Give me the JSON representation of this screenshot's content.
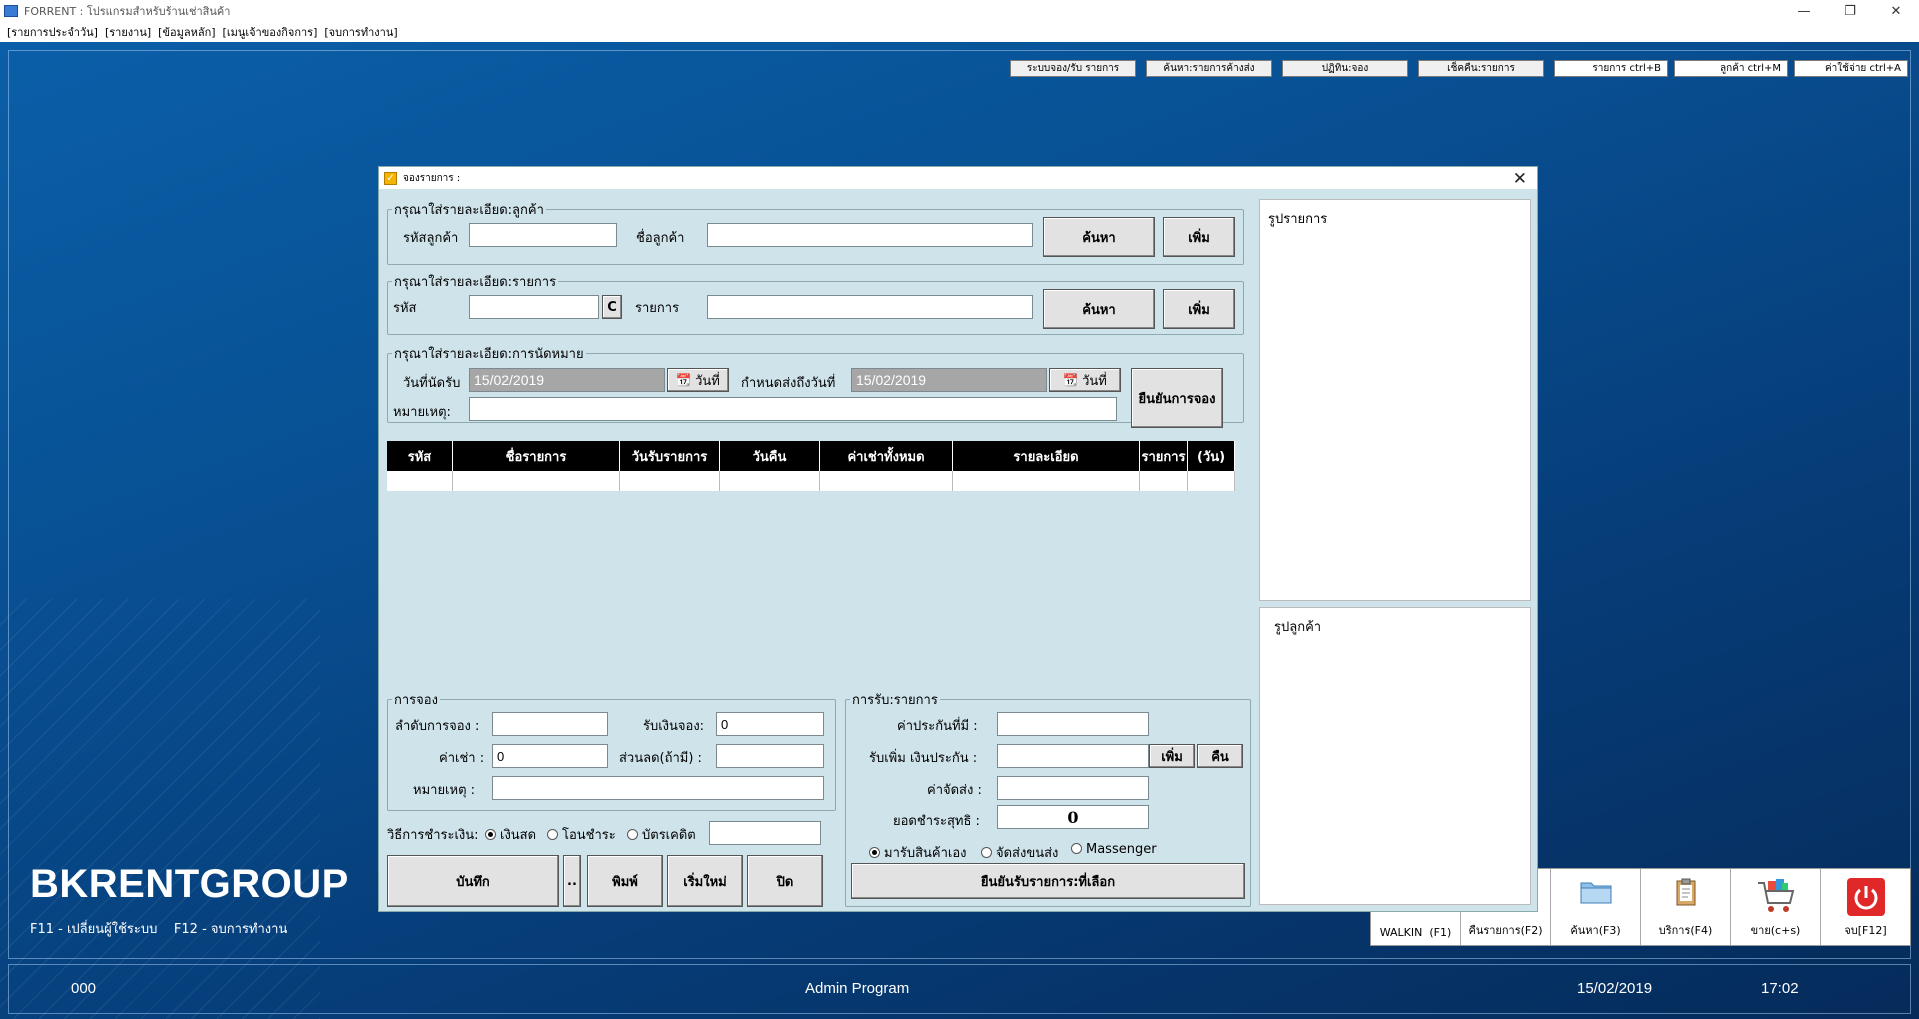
{
  "window": {
    "title": "FORRENT : โปรแกรมสำหรับร้านเช่าสินค้า",
    "controls": [
      "—",
      "❐",
      "✕"
    ]
  },
  "menu": [
    "[รายการประจำวัน]",
    "[รายงาน]",
    "[ข้อมูลหลัก]",
    "[เมนูเจ้าของกิจการ]",
    "[จบการทำงาน]"
  ],
  "top_buttons": [
    "ระบบจอง/รับ รายการ",
    "ค้นหา:รายการค้างส่ง",
    "ปฏิทิน:จอง",
    "เช็คคืน:รายการ",
    "รายการ ctrl+B",
    "ลูกค้า ctrl+M",
    "ค่าใช้จ่าย ctrl+A"
  ],
  "dialog": {
    "title": "จองรายการ :",
    "customer": {
      "legend": "กรุณาใส่รายละเอียด:ลูกค้า",
      "code_label": "รหัสลูกค้า",
      "code_value": "",
      "name_label": "ชื่อลูกค้า",
      "name_value": "",
      "search": "ค้นหา",
      "add": "เพิ่ม"
    },
    "item": {
      "legend": "กรุณาใส่รายละเอียด:รายการ",
      "code_label": "รหัส",
      "code_value": "",
      "c_button": "C",
      "item_label": "รายการ",
      "item_value": "",
      "search": "ค้นหา",
      "add": "เพิ่ม"
    },
    "appointment": {
      "legend": "กรุณาใส่รายละเอียด:การนัดหมาย",
      "pickup_label": "วันที่นัดรับ",
      "pickup_date": "15/02/2019",
      "date_button": "วันที่",
      "return_label": "กำหนดส่งถึงวันที่",
      "return_date": "15/02/2019",
      "note_label": "หมายเหตุ:",
      "note_value": "",
      "confirm": "ยืนยันการจอง"
    },
    "table": {
      "columns": [
        "รหัส",
        "ชื่อรายการ",
        "วันรับรายการ",
        "วันคืน",
        "ค่าเช่าทั้งหมด",
        "รายละเอียด",
        "รายการ",
        "(วัน)"
      ]
    },
    "booking": {
      "legend": "การจอง",
      "seq_label": "ลำดับการจอง :",
      "seq_value": "",
      "deposit_label": "รับเงินจอง:",
      "deposit_value": "0",
      "rent_label": "ค่าเช่า :",
      "rent_value": "0",
      "discount_label": "ส่วนลด(ถ้ามี) :",
      "discount_value": "",
      "note_label": "หมายเหตุ :",
      "note_value": ""
    },
    "payment": {
      "label": "วิธีการชำระเงิน:",
      "options": [
        "เงินสด",
        "โอนชำระ",
        "บัตรเคดิต"
      ],
      "selected": "เงินสด",
      "extra_value": ""
    },
    "actions": [
      "บันทึก",
      "..",
      "พิมพ์",
      "เริ่มใหม่",
      "ปิด"
    ],
    "receive": {
      "legend": "การรับ:รายการ",
      "insurance_label": "ค่าประกันที่มี :",
      "insurance_value": "",
      "extra_label": "รับเพิ่ม เงินประกัน :",
      "extra_value": "",
      "add": "เพิ่ม",
      "refund": "คืน",
      "shipping_label": "ค่าจัดส่ง :",
      "shipping_value": "",
      "net_label": "ยอดชำระสุทธิ :",
      "net_value": "0",
      "delivery_options": [
        "มารับสินค้าเอง",
        "จัดส่งขนส่ง",
        "Massenger"
      ],
      "delivery_selected": "มารับสินค้าเอง",
      "confirm": "ยืนยันรับรายการ:ที่เลือก"
    },
    "item_image_label": "รูปรายการ",
    "customer_image_label": "รูปลูกค้า"
  },
  "brand": {
    "name": "BKRENTGROUP",
    "help": "F11 - เปลี่ยนผู้ใช้ระบบ    F12 - จบการทำงาน"
  },
  "function_bar": [
    {
      "label": "WALKIN  (F1)",
      "icon": "none"
    },
    {
      "label": "คืนรายการ(F2)",
      "icon": "none"
    },
    {
      "label": "ค้นหา(F3)",
      "icon": "folder-icon"
    },
    {
      "label": "บริการ(F4)",
      "icon": "clipboard-icon"
    },
    {
      "label": "ขาย(c+s)",
      "icon": "cart-icon"
    },
    {
      "label": "จบ[F12]",
      "icon": "power-icon"
    }
  ],
  "status": {
    "code": "000",
    "program": "Admin Program",
    "date": "15/02/2019",
    "time": "17:02"
  }
}
